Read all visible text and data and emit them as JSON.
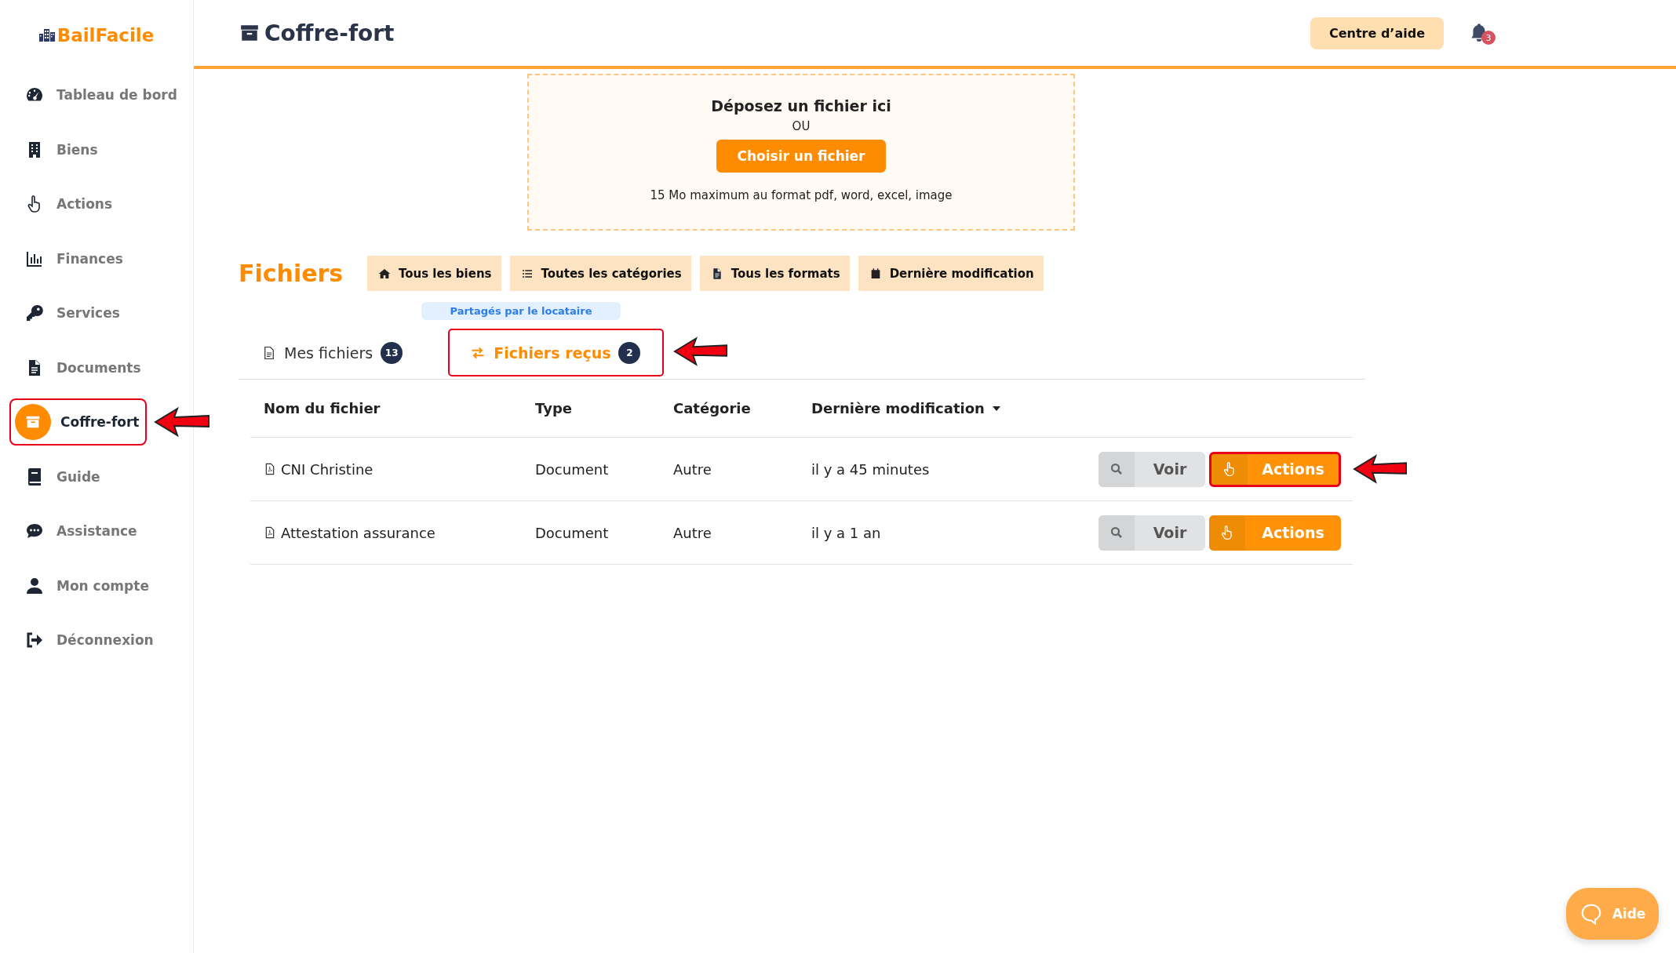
{
  "brand": "BailFacile",
  "sidebar": {
    "items": [
      {
        "label": "Tableau de bord",
        "selected": false,
        "annotated": false
      },
      {
        "label": "Biens",
        "selected": false,
        "annotated": false
      },
      {
        "label": "Actions",
        "selected": false,
        "annotated": false
      },
      {
        "label": "Finances",
        "selected": false,
        "annotated": false
      },
      {
        "label": "Services",
        "selected": false,
        "annotated": false
      },
      {
        "label": "Documents",
        "selected": false,
        "annotated": false
      },
      {
        "label": "Coffre-fort",
        "selected": true,
        "annotated": true
      },
      {
        "label": "Guide",
        "selected": false,
        "annotated": false
      },
      {
        "label": "Assistance",
        "selected": false,
        "annotated": false
      },
      {
        "label": "Mon compte",
        "selected": false,
        "annotated": false
      },
      {
        "label": "Déconnexion",
        "selected": false,
        "annotated": false
      }
    ]
  },
  "header": {
    "title": "Coffre-fort",
    "help_button": "Centre d’aide",
    "notification_count": "3"
  },
  "upload": {
    "title": "Déposez un fichier ici",
    "separator": "OU",
    "button": "Choisir un fichier",
    "hint": "15 Mo maximum au format pdf, word, excel, image"
  },
  "files": {
    "title": "Fichiers",
    "filters": [
      {
        "label": "Tous les biens"
      },
      {
        "label": "Toutes les catégories"
      },
      {
        "label": "Tous les formats"
      },
      {
        "label": "Dernière modification"
      }
    ],
    "shared_badge": "Partagés par le locataire",
    "tabs": [
      {
        "label": "Mes fichiers",
        "count": "13",
        "selected": false,
        "annotated": false
      },
      {
        "label": "Fichiers reçus",
        "count": "2",
        "selected": true,
        "annotated": true
      }
    ],
    "table": {
      "columns": [
        {
          "label": "Nom du fichier",
          "sorted": false
        },
        {
          "label": "Type",
          "sorted": false
        },
        {
          "label": "Catégorie",
          "sorted": false
        },
        {
          "label": "Dernière modification",
          "sorted": true
        }
      ],
      "rows": [
        {
          "name": "CNI Christine",
          "type": "Document",
          "category": "Autre",
          "modified": "il y a 45 minutes",
          "view_button": "Voir",
          "actions_button": "Actions",
          "annotated": true
        },
        {
          "name": "Attestation assurance",
          "type": "Document",
          "category": "Autre",
          "modified": "il y a 1 an",
          "view_button": "Voir",
          "actions_button": "Actions",
          "annotated": false
        }
      ]
    }
  },
  "help_widget": {
    "label": "Aide"
  }
}
